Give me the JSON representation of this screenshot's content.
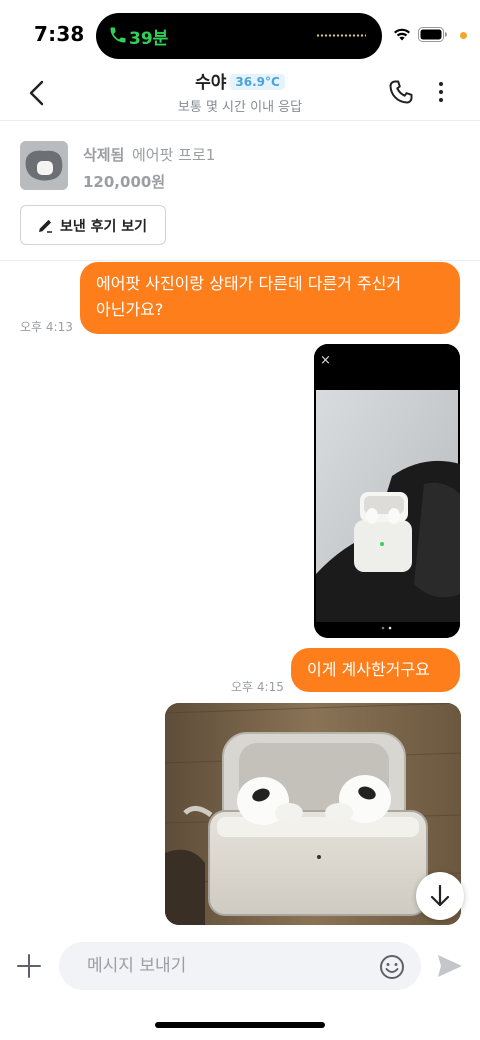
{
  "status_bar": {
    "time": "7:38",
    "call_duration": "39분",
    "call_color": "#30d158",
    "icons": [
      "phone-icon",
      "wifi-icon",
      "battery-icon",
      "privacy-dot"
    ]
  },
  "header": {
    "back_icon": "chevron-left-icon",
    "name": "수야",
    "temperature": "36.9°C",
    "subtitle": "보통 몇 시간 이내 응답",
    "actions": [
      "phone-icon",
      "more-vertical-icon"
    ]
  },
  "product": {
    "status": "삭제됨",
    "name": "에어팟 프로1",
    "price": "120,000원",
    "review_button_label": "보낸 후기 보기",
    "review_button_icon": "pencil-icon"
  },
  "messages": [
    {
      "type": "text",
      "sender": "me",
      "text_line1": "에어팟 사진이랑 상태가 다른데 다른거 주신거",
      "text_line2": "아닌가요?",
      "time": "오후 4:13"
    },
    {
      "type": "image",
      "sender": "me",
      "description_icon": "airpods-case-photo",
      "close_glyph": "×"
    },
    {
      "type": "text",
      "sender": "me",
      "text": "이게 계사한거구요",
      "time": "오후 4:15"
    },
    {
      "type": "image",
      "sender": "me",
      "description_icon": "airpods-open-case-photo"
    }
  ],
  "composer": {
    "placeholder": "메시지 보내기",
    "icons": [
      "plus-icon",
      "emoji-icon",
      "send-icon"
    ]
  },
  "colors": {
    "accent": "#ff7e1c",
    "temperature_badge_bg": "#e7f3fc",
    "temperature_badge_text": "#4aa3d8",
    "muted_text": "#9b9ea3"
  }
}
